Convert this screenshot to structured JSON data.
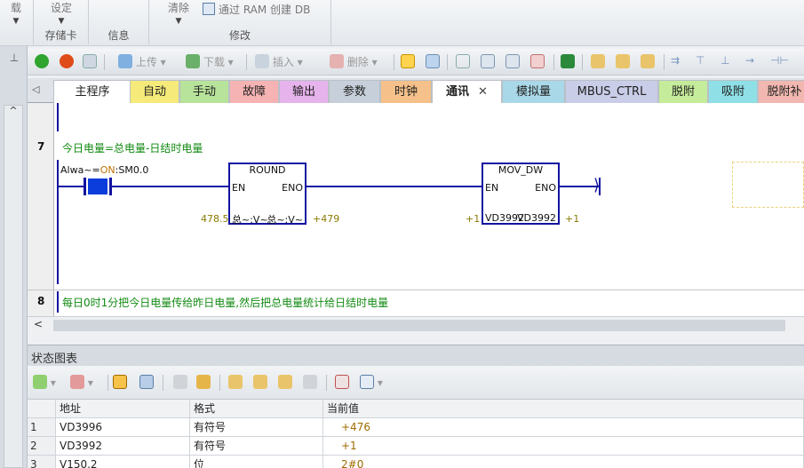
{
  "ribbon": {
    "top_left_button": "载",
    "settings_button": "设定",
    "clear_button": "清除",
    "create_db_button": "通过 RAM 创建 DB",
    "groups": [
      "存储卡",
      "信息",
      "修改"
    ]
  },
  "toolbar": {
    "upload": "上传",
    "download": "下载",
    "insert": "插入",
    "delete": "删除"
  },
  "tabs": [
    {
      "label": "主程序",
      "color": "#ffffff"
    },
    {
      "label": "自动",
      "color": "#f5ea7a"
    },
    {
      "label": "手动",
      "color": "#b8e39a"
    },
    {
      "label": "故障",
      "color": "#f6b3b3"
    },
    {
      "label": "输出",
      "color": "#e7b3ec"
    },
    {
      "label": "参数",
      "color": "#c7d0da"
    },
    {
      "label": "时钟",
      "color": "#f5c08a"
    },
    {
      "label": "通讯",
      "color": "#ffffff",
      "active": true
    },
    {
      "label": "模拟量",
      "color": "#a9d8e8"
    },
    {
      "label": "MBUS_CTRL",
      "color": "#c9cde8"
    },
    {
      "label": "脱附",
      "color": "#c5ec9a"
    },
    {
      "label": "吸附",
      "color": "#8ee0e6"
    },
    {
      "label": "脱附补",
      "color": "#f1b7b0"
    }
  ],
  "tab_close_glyph": "✕",
  "editor": {
    "network7": {
      "number": "7",
      "comment": "今日电量=总电量-日结时电量",
      "contact_label": "Alwa~=",
      "contact_on": "ON",
      "contact_addr": ":SM0.0",
      "round_block": {
        "title": "ROUND",
        "en": "EN",
        "eno": "ENO",
        "in_value": "478.5",
        "in_label": "总~:V~",
        "out_label": "总~:V~",
        "out_value": "+479"
      },
      "mov_block": {
        "title": "MOV_DW",
        "en": "EN",
        "eno": "ENO",
        "in_value": "+1",
        "in_label": "VD3992",
        "out_label": "VD3992",
        "out_value": "+1"
      }
    },
    "network8": {
      "number": "8",
      "comment": "每日0时1分把今日电量传给昨日电量,然后把总电量统计给日结时电量"
    }
  },
  "status_chart": {
    "title": "状态图表",
    "columns": [
      "地址",
      "格式",
      "当前值"
    ],
    "rows": [
      {
        "num": "1",
        "address": "VD3996",
        "format": "有符号",
        "value": "+476"
      },
      {
        "num": "2",
        "address": "VD3992",
        "format": "有符号",
        "value": "+1"
      },
      {
        "num": "3",
        "address": "V150.2",
        "format": "位",
        "value": "2#0"
      }
    ]
  },
  "colors": {
    "wire": "#1212a0",
    "comment": "#128a12",
    "value": "#a06b00"
  }
}
